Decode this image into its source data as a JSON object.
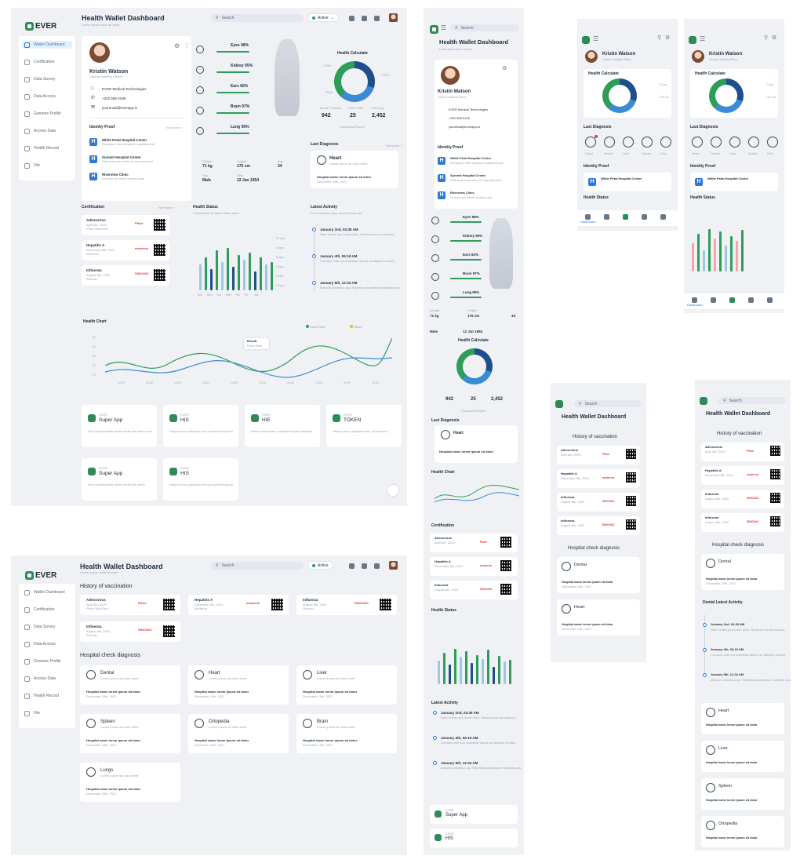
{
  "app": {
    "logo": "EVER",
    "title": "Health Wallet Dashboard",
    "subtitle": "Lorem ipsum dolor sit amet"
  },
  "search": {
    "placeholder": "Search"
  },
  "status": {
    "label": "Active"
  },
  "sidebar": {
    "items": [
      {
        "label": "Wallet Dashboard",
        "icon": "dashboard-icon"
      },
      {
        "label": "Certification",
        "icon": "certificate-icon"
      },
      {
        "label": "Data Survey",
        "icon": "survey-icon"
      },
      {
        "label": "Data Access",
        "icon": "access-icon"
      },
      {
        "label": "Genome Profile",
        "icon": "genome-icon"
      },
      {
        "label": "Access Data",
        "icon": "chart-icon"
      },
      {
        "label": "Health Record",
        "icon": "record-icon"
      },
      {
        "label": "File",
        "icon": "folder-icon"
      }
    ]
  },
  "profile": {
    "name": "Kristin Watson",
    "role": "Central Usability Officer",
    "company": "EVER Medical Technologies",
    "phone": "+202 555 0199",
    "email": "youremail@everapp.io"
  },
  "identity": {
    "title": "Identity Proof",
    "see_more": "See more >",
    "items": [
      {
        "name": "White Petal Hospital Center",
        "desc": "Excepteur sint occaecat cupidatat non"
      },
      {
        "name": "Summit Hospital Center",
        "desc": "Duis aute irure dolor in reprehenderit"
      },
      {
        "name": "Riverview Clinic",
        "desc": "Ut enim ad minim veniam quis"
      }
    ]
  },
  "vitals": [
    {
      "label": "Eyes 98%"
    },
    {
      "label": "Kidney 95%"
    },
    {
      "label": "Ears 82%"
    },
    {
      "label": "Brain 97%"
    },
    {
      "label": "Lung 95%"
    }
  ],
  "body_stats": {
    "weight_label": "Weight",
    "weight": "71 kg",
    "height_label": "Height",
    "height": "176 cm",
    "age_label": "Age",
    "age": "34",
    "sex_label": "Sex",
    "sex": "Male",
    "birth_label": "Birth",
    "birth": "12 Jan 1954"
  },
  "calculate": {
    "title": "Health Calculate",
    "p1": "+23%",
    "p2": "+32%",
    "p3": "+54%",
    "leg1": "Blood Pressure",
    "leg2": "Heart Rate",
    "leg3": "Running",
    "v1": "942",
    "v2": "25",
    "v3": "2,452",
    "download": "Download Report"
  },
  "diagnosis": {
    "title": "Last Diagnosis",
    "see_more": "See more >",
    "organ": "Heart",
    "organ_desc": "Lorem ipsum sit dolor amet",
    "hospital": "Hospital name lorem ipsum sit dolor",
    "date": "December 19th, 2021"
  },
  "certification": {
    "title": "Certification",
    "see_more": "See more >",
    "items": [
      {
        "name": "Adenovirus",
        "date": "April 6th, 2020",
        "maker": "Pfizer BioNTech",
        "brand": "Pfizer"
      },
      {
        "name": "Hepatitis A",
        "date": "December 8th, 2021",
        "maker": "Moderna",
        "brand": "moderna"
      },
      {
        "name": "Influenza",
        "date": "August 8th, 2020",
        "maker": "Sinovac",
        "brand": "SINOVAC"
      }
    ]
  },
  "health_status": {
    "title": "Health Status",
    "subtitle": "Consectetur sit ipsum dolor amet",
    "days": [
      "Sun",
      "Mon",
      "Tue",
      "Wed",
      "Thu",
      "Fri",
      "Sat"
    ],
    "yticks": [
      "10 bpm",
      "8 bpm",
      "6 bpm",
      "4 bpm",
      "2 bpm",
      "0 bpm"
    ]
  },
  "activity": {
    "title": "Latest Activity",
    "subtitle": "Sit ut tempora dolor amet sit quis qui",
    "items": [
      {
        "date": "January 2nd, 04:35 AM",
        "text": "Nam veritat quo lorem dolor. Nesciunt vel accusamus."
      },
      {
        "date": "January 4th, 06:19 AM",
        "text": "Corrupti unde qui molestiae labore ad adipisci veniam."
      },
      {
        "date": "January 5th, 12:34 AM",
        "text": "Maiores doloribus qui. Repellat accusamus molestias quo."
      }
    ]
  },
  "health_chart": {
    "title": "Health Chart",
    "legend1": "Heart Rate",
    "legend2": "Blood",
    "tooltip_title": "Result",
    "tooltip_sub": "Heart Rate",
    "xticks": [
      "14:00",
      "14:00",
      "14:00",
      "14:00",
      "14:00",
      "14:00",
      "14:00",
      "14:00",
      "14:00",
      "14:00"
    ],
    "yticks": [
      "50",
      "40",
      "30",
      "20",
      "10"
    ]
  },
  "apps": [
    {
      "brand": "EVER",
      "name": "Super App",
      "desc": "Sed ut perspiciatis unde omnis iste natus error"
    },
    {
      "brand": "EVER",
      "name": "HIS",
      "desc": "Neque porro quisquam est qui dolorem ipsum"
    },
    {
      "brand": "EVER",
      "name": "HIE",
      "desc": "Nemo enim ipsam voluptatem quia voluptas"
    },
    {
      "brand": "EVER",
      "name": "TOKEN",
      "desc": "Neque porro quisquam est, qui dolorem"
    },
    {
      "brand": "EVER",
      "name": "Super App",
      "desc": "Sed ut perspiciatis unde omnis iste natus"
    },
    {
      "brand": "EVER",
      "name": "HIS",
      "desc": "Neque porro quisquam est qui dolorem ipsum"
    }
  ],
  "vaccination": {
    "title": "History of vaccination",
    "items": [
      {
        "name": "Adenovirus",
        "date": "April 6th, 2020",
        "maker": "Pfizer BioNTech",
        "brand": "Pfizer"
      },
      {
        "name": "Hepatitis A",
        "date": "December 8th, 2021",
        "maker": "Moderna",
        "brand": "moderna"
      },
      {
        "name": "Influenza",
        "date": "August 8th, 2020",
        "maker": "Sinovac",
        "brand": "SINOVAC"
      },
      {
        "name": "Influenza",
        "date": "August 8th, 2020",
        "maker": "Sinovac",
        "brand": "SINOVAC"
      }
    ]
  },
  "hospital_check": {
    "title": "Hospital check diagnosis",
    "items": [
      {
        "organ": "Dental",
        "desc": "Lorem ipsum sit dolor amet",
        "hospital": "Hospital name lorem ipsum sit dolor",
        "date": "December 19th, 2021"
      },
      {
        "organ": "Heart",
        "desc": "Lorem ipsum sit dolor amet",
        "hospital": "Hospital name lorem ipsum sit dolor",
        "date": "December 19th, 2021"
      },
      {
        "organ": "Liver",
        "desc": "Lorem ipsum sit dolor amet",
        "hospital": "Hospital name lorem ipsum sit dolor",
        "date": "December 19th, 2021"
      },
      {
        "organ": "Spleen",
        "desc": "Lorem ipsum sit dolor amet",
        "hospital": "Hospital name lorem ipsum sit dolor",
        "date": "December 19th, 2021"
      },
      {
        "organ": "Ortopedia",
        "desc": "Lorem ipsum sit dolor amet",
        "hospital": "Hospital name lorem ipsum sit dolor",
        "date": "December 19th, 2021"
      },
      {
        "organ": "Brain",
        "desc": "Lorem ipsum sit dolor amet",
        "hospital": "Hospital name lorem ipsum sit dolor",
        "date": "December 19th, 2021"
      },
      {
        "organ": "Lungs",
        "desc": "Lorem ipsum sit dolor amet",
        "hospital": "Hospital name lorem ipsum sit dolor",
        "date": "December 19th, 2021"
      }
    ]
  },
  "dental_activity": {
    "title": "Dental Latest Activity"
  },
  "mobile_nav": {
    "dashboard": "Dashboard"
  },
  "mobile_diag_labels": [
    "Heart",
    "Dental",
    "Liver",
    "Spleen",
    "Orto"
  ],
  "colors": {
    "accent": "#2a7ad6",
    "green": "#2e9d5a",
    "navy": "#1f4e8c",
    "bg": "#f0f1f5"
  }
}
